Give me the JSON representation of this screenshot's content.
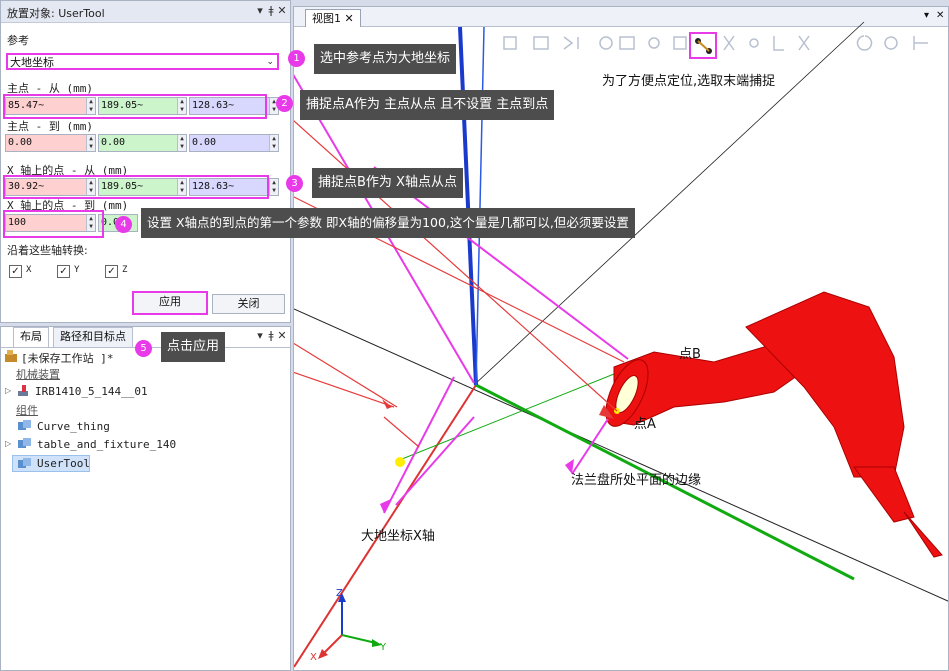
{
  "panel": {
    "title": "放置对象: UserTool",
    "reference_label": "参考",
    "reference_value": "大地坐标",
    "main_from_label": "主点 - 从 (mm)",
    "main_from": [
      "85.47~",
      "189.05~",
      "128.63~"
    ],
    "main_to_label": "主点 - 到 (mm)",
    "main_to": [
      "0.00",
      "0.00",
      "0.00"
    ],
    "xfrom_label": "X 轴上的点 - 从 (mm)",
    "xfrom": [
      "30.92~",
      "189.05~",
      "128.63~"
    ],
    "xto_label": "X 轴上的点 - 到 (mm)",
    "xto": [
      "100",
      "0.0"
    ],
    "axes_label": "沿着这些轴转换:",
    "axes": [
      "X",
      "Y",
      "Z"
    ],
    "apply": "应用",
    "close": "关闭"
  },
  "tree": {
    "tabs": [
      "布局",
      "路径和目标点"
    ],
    "station": "[未保存工作站 ]*",
    "mech_group": "机械装置",
    "robot": "IRB1410_5_144__01",
    "parts_group": "组件",
    "items": [
      "Curve_thing",
      "table_and_fixture_140",
      "UserTool"
    ]
  },
  "viewport": {
    "tab": "视图1"
  },
  "callouts": {
    "c1": "选中参考点为大地坐标",
    "c2": "捕捉点A作为 主点从点 且不设置 主点到点",
    "c3": "捕捉点B作为 X轴点从点",
    "c4": "设置 X轴点的到点的第一个参数 即X轴的偏移量为100,这个量是几都可以,但必须要设置",
    "c5": "点击应用",
    "snap_note": "为了方便点定位,选取末端捕捉",
    "pointB": "点B",
    "pointA": "点A",
    "flange": "法兰盘所处平面的边缘",
    "worldx": "大地坐标X轴",
    "badges": [
      "1",
      "2",
      "3",
      "4",
      "5"
    ]
  },
  "axis_labels": [
    "Z",
    "Y",
    "X"
  ],
  "colors": {
    "highlight": "#e83ae8",
    "callout_bg": "#4d4d4d",
    "robot": "#ee1111",
    "red_field": "#ffd0d0",
    "green_field": "#ccf5cc",
    "blue_field": "#d8d8ff"
  }
}
